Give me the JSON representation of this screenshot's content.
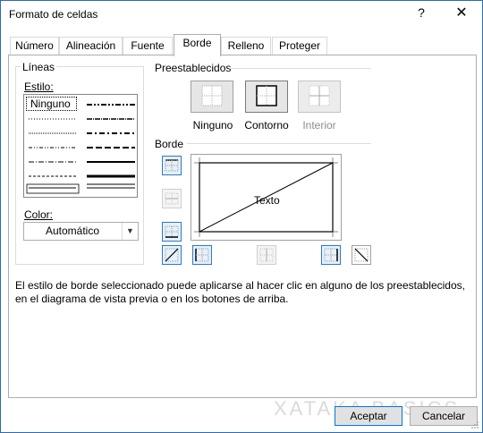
{
  "window": {
    "title": "Formato de celdas",
    "help_glyph": "?",
    "close_glyph": "✕"
  },
  "tabs": [
    {
      "label": "Número"
    },
    {
      "label": "Alineación"
    },
    {
      "label": "Fuente"
    },
    {
      "label": "Borde",
      "active": true
    },
    {
      "label": "Relleno"
    },
    {
      "label": "Proteger"
    }
  ],
  "lines": {
    "group_label": "Líneas",
    "style_label": "Estilo:",
    "none_label": "Ninguno",
    "color_label": "Color:",
    "color_value": "Automático"
  },
  "presets": {
    "group_label": "Preestablecidos",
    "items": [
      {
        "label": "Ninguno"
      },
      {
        "label": "Contorno"
      },
      {
        "label": "Interior",
        "disabled": true
      }
    ]
  },
  "border": {
    "group_label": "Borde",
    "preview_text": "Texto"
  },
  "description": "El estilo de borde seleccionado puede aplicarse al hacer clic en alguno de los preestablecidos, en el diagrama de vista previa o en los botones de arriba.",
  "footer": {
    "accept_label": "Aceptar",
    "cancel_label": "Cancelar",
    "watermark": "XATAKA BASICS"
  },
  "colors": {
    "accent": "#0078d7",
    "dialog_border": "#2b6cb0"
  }
}
